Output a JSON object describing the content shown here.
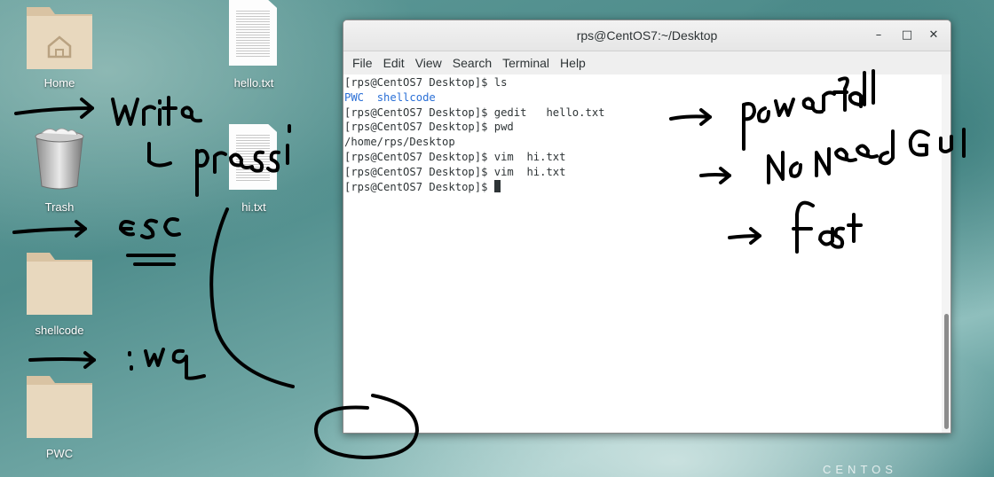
{
  "desktop": {
    "icons": [
      {
        "label": "Home",
        "type": "folder"
      },
      {
        "label": "hello.txt",
        "type": "file"
      },
      {
        "label": "Trash",
        "type": "trash"
      },
      {
        "label": "hi.txt",
        "type": "file"
      },
      {
        "label": "shellcode",
        "type": "folder"
      },
      {
        "label": "PWC",
        "type": "folder"
      }
    ],
    "brand": "CENTOS"
  },
  "window": {
    "title": "rps@CentOS7:~/Desktop",
    "controls": {
      "minimize": "–",
      "maximize": "□",
      "close": "✕"
    },
    "menu": [
      "File",
      "Edit",
      "View",
      "Search",
      "Terminal",
      "Help"
    ]
  },
  "terminal": {
    "lines": [
      "[rps@CentOS7 Desktop]$ ls",
      "",
      "[rps@CentOS7 Desktop]$ gedit   hello.txt",
      "[rps@CentOS7 Desktop]$ pwd",
      "/home/rps/Desktop",
      "[rps@CentOS7 Desktop]$ vim  hi.txt",
      "[rps@CentOS7 Desktop]$ vim  hi.txt",
      "[rps@CentOS7 Desktop]$ "
    ],
    "ls_output": [
      "PWC",
      "shellcode"
    ],
    "colors": {
      "directory": "#2a6fd6",
      "text": "#2e3436"
    }
  },
  "annotations": {
    "left": [
      "write",
      "press i",
      "esc",
      ":wq"
    ],
    "right": [
      "powerfull",
      "No Need GUI",
      "fast"
    ],
    "ink_color": "#000000"
  }
}
